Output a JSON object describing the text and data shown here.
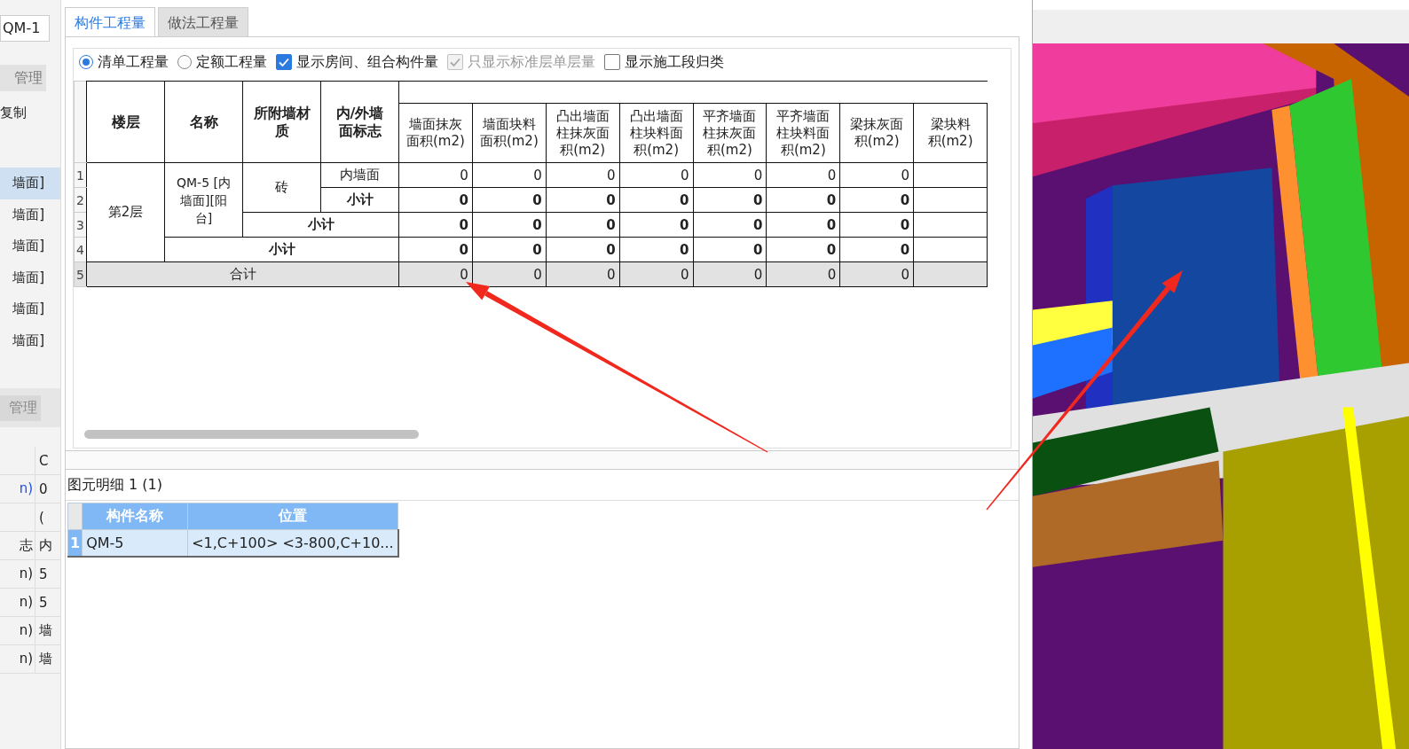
{
  "left_panel": {
    "name_field": {
      "value": "QM-1"
    },
    "tab_top": {
      "label": "管理"
    },
    "toolbar_label": "复制",
    "items": [
      {
        "label": "墙面]",
        "selected": true
      },
      {
        "label": "墙面]",
        "selected": false
      },
      {
        "label": "墙面]",
        "selected": false
      },
      {
        "label": "墙面]",
        "selected": false
      },
      {
        "label": "墙面]",
        "selected": false
      },
      {
        "label": "墙面]",
        "selected": false
      }
    ],
    "tab_bottom": {
      "label": "管理"
    },
    "properties": [
      {
        "value": "C"
      },
      {
        "name": "n)",
        "value": "0",
        "highlighted": true
      },
      {
        "value": "("
      },
      {
        "name": "志",
        "value": "内",
        "highlighted": false
      },
      {
        "name": "n)",
        "value": "5",
        "highlighted": false
      },
      {
        "name": "n)",
        "value": "5",
        "highlighted": false
      },
      {
        "name": "n)",
        "value": "墙",
        "highlighted": false
      },
      {
        "name": "n)",
        "value": "墙",
        "highlighted": false
      }
    ]
  },
  "dialog": {
    "tabs": [
      {
        "label": "构件工程量",
        "selected": true
      },
      {
        "label": "做法工程量",
        "selected": false
      }
    ],
    "options": [
      {
        "kind": "radio",
        "label": "清单工程量",
        "checked": true,
        "disabled": false
      },
      {
        "kind": "radio",
        "label": "定额工程量",
        "checked": false,
        "disabled": false
      },
      {
        "kind": "checkbox",
        "label": "显示房间、组合构件量",
        "checked": true,
        "disabled": false
      },
      {
        "kind": "checkbox",
        "label": "只显示标准层单层量",
        "checked": true,
        "disabled": true
      },
      {
        "kind": "checkbox",
        "label": "显示施工段归类",
        "checked": false,
        "disabled": false
      }
    ],
    "table": {
      "row_numbers": [
        "1",
        "2",
        "3",
        "4",
        "5"
      ],
      "key_columns": [
        [
          "楼层"
        ],
        [
          "名称"
        ],
        [
          "所附墙材",
          "质"
        ],
        [
          "内/外墙",
          "面标志"
        ]
      ],
      "value_columns": [
        [
          "墙面抹灰",
          "面积(m2)"
        ],
        [
          "墙面块料",
          "面积(m2)"
        ],
        [
          "凸出墙面",
          "柱抹灰面",
          "积(m2)"
        ],
        [
          "凸出墙面",
          "柱块料面",
          "积(m2)"
        ],
        [
          "平齐墙面",
          "柱抹灰面",
          "积(m2)"
        ],
        [
          "平齐墙面",
          "柱块料面",
          "积(m2)"
        ],
        [
          "梁抹灰面",
          "积(m2)"
        ],
        [
          "梁块料",
          "积(m2)"
        ]
      ],
      "floor": "第2层",
      "name": [
        "QM-5 [内",
        "墙面][阳",
        "台]"
      ],
      "material": "砖",
      "face": {
        "label": "内墙面",
        "values": [
          "0",
          "0",
          "0",
          "0",
          "0",
          "0",
          "0"
        ]
      },
      "material_subtotal": {
        "label": "小计",
        "values": [
          "0",
          "0",
          "0",
          "0",
          "0",
          "0",
          "0"
        ]
      },
      "name_subtotal": {
        "label": "小计",
        "values": [
          "0",
          "0",
          "0",
          "0",
          "0",
          "0",
          "0"
        ]
      },
      "floor_subtotal": {
        "label": "小计",
        "values": [
          "0",
          "0",
          "0",
          "0",
          "0",
          "0",
          "0"
        ]
      },
      "total": {
        "label": "合计",
        "values": [
          "0",
          "0",
          "0",
          "0",
          "0",
          "0",
          "0"
        ]
      }
    },
    "detail": {
      "title": "图元明细  1 (1)",
      "columns": [
        "构件名称",
        "位置"
      ],
      "rows": [
        {
          "number": "1",
          "selected": true,
          "cells": [
            "QM-5",
            "<1,C+100> <3-800,C+10..."
          ]
        }
      ]
    }
  }
}
